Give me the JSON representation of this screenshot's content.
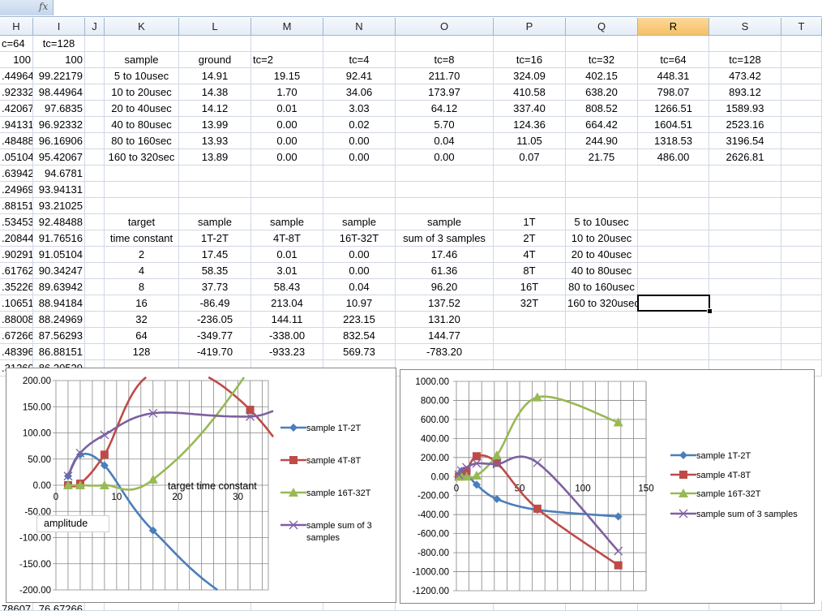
{
  "formula_bar": {
    "fx_label": "fx"
  },
  "columns": [
    "H",
    "I",
    "J",
    "K",
    "L",
    "M",
    "N",
    "O",
    "P",
    "Q",
    "R",
    "S",
    "T"
  ],
  "selected_column": "R",
  "rows": [
    [
      "c=64",
      "tc=128",
      null,
      null,
      null,
      null,
      null,
      null,
      null,
      null,
      null,
      null
    ],
    [
      "100",
      "100",
      null,
      "sample",
      "ground",
      "tc=2",
      "tc=4",
      "tc=8",
      "tc=16",
      "tc=32",
      "tc=64",
      "tc=128"
    ],
    [
      ".44964",
      "99.22179",
      null,
      "5 to 10usec",
      "14.91",
      "19.15",
      "92.41",
      "211.70",
      "324.09",
      "402.15",
      "448.31",
      "473.42"
    ],
    [
      ".92332",
      "98.44964",
      null,
      "10 to 20usec",
      "14.38",
      "1.70",
      "34.06",
      "173.97",
      "410.58",
      "638.20",
      "798.07",
      "893.12"
    ],
    [
      ".42067",
      "97.6835",
      null,
      "20 to 40usec",
      "14.12",
      "0.01",
      "3.03",
      "64.12",
      "337.40",
      "808.52",
      "1266.51",
      "1589.93"
    ],
    [
      ".94131",
      "96.92332",
      null,
      "40 to 80usec",
      "13.99",
      "0.00",
      "0.02",
      "5.70",
      "124.36",
      "664.42",
      "1604.51",
      "2523.16"
    ],
    [
      ".48488",
      "96.16906",
      null,
      "80 to 160sec",
      "13.93",
      "0.00",
      "0.00",
      "0.04",
      "11.05",
      "244.90",
      "1318.53",
      "3196.54"
    ],
    [
      ".05104",
      "95.42067",
      null,
      "160 to 320sec",
      "13.89",
      "0.00",
      "0.00",
      "0.00",
      "0.07",
      "21.75",
      "486.00",
      "2626.81"
    ],
    [
      ".63942",
      "94.6781",
      null,
      null,
      null,
      null,
      null,
      null,
      null,
      null,
      null,
      null
    ],
    [
      ".24969",
      "93.94131",
      null,
      null,
      null,
      null,
      null,
      null,
      null,
      null,
      null,
      null
    ],
    [
      ".88151",
      "93.21025",
      null,
      null,
      null,
      null,
      null,
      null,
      null,
      null,
      null,
      null
    ],
    [
      ".53453",
      "92.48488",
      null,
      "target",
      "sample",
      "sample",
      "sample",
      "sample",
      "1T",
      "5 to 10usec",
      null,
      null
    ],
    [
      ".20844",
      "91.76516",
      null,
      "time constant",
      "1T-2T",
      "4T-8T",
      "16T-32T",
      "sum of 3 samples",
      "2T",
      "10 to 20usec",
      null,
      null
    ],
    [
      ".90291",
      "91.05104",
      null,
      "2",
      "17.45",
      "0.01",
      "0.00",
      "17.46",
      "4T",
      "20 to 40usec",
      null,
      null
    ],
    [
      ".61762",
      "90.34247",
      null,
      "4",
      "58.35",
      "3.01",
      "0.00",
      "61.36",
      "8T",
      "40 to 80usec",
      null,
      null
    ],
    [
      ".35226",
      "89.63942",
      null,
      "8",
      "37.73",
      "58.43",
      "0.04",
      "96.20",
      "16T",
      "80 to 160usec",
      null,
      null
    ],
    [
      ".10651",
      "88.94184",
      null,
      "16",
      "-86.49",
      "213.04",
      "10.97",
      "137.52",
      "32T",
      "160 to 320usec",
      null,
      null
    ],
    [
      ".88008",
      "88.24969",
      null,
      "32",
      "-236.05",
      "144.11",
      "223.15",
      "131.20",
      null,
      null,
      null,
      null
    ],
    [
      ".67266",
      "87.56293",
      null,
      "64",
      "-349.77",
      "-338.00",
      "832.54",
      "144.77",
      null,
      null,
      null,
      null
    ],
    [
      ".48396",
      "86.88151",
      null,
      "128",
      "-419.70",
      "-933.23",
      "569.73",
      "-783.20",
      null,
      null,
      null,
      null
    ],
    [
      ".31260",
      "86.20529",
      null,
      null,
      null,
      null,
      null,
      null,
      null,
      null,
      null,
      null
    ]
  ],
  "bottom_row": [
    "78607",
    "76.67266"
  ],
  "chart_data": [
    {
      "type": "line",
      "title": "",
      "xlabel": "target time constant",
      "ylabel": "amplitude",
      "xlim": [
        0,
        35
      ],
      "ylim": [
        -200,
        200
      ],
      "yticks": [
        "200.00",
        "150.00",
        "100.00",
        "50.00",
        "0.00",
        "-50.00",
        "-100.00",
        "-150.00",
        "-200.00"
      ],
      "ytick_values": [
        200,
        150,
        100,
        50,
        0,
        -50,
        -100,
        -150,
        -200
      ],
      "xticks": [
        "0",
        "10",
        "20",
        "30"
      ],
      "xtick_values": [
        0,
        10,
        20,
        30
      ],
      "grid": true,
      "legend": "right",
      "x": [
        2,
        4,
        8,
        16,
        32,
        64,
        128
      ],
      "series": [
        {
          "name": "sample 1T-2T",
          "values": [
            17.45,
            58.35,
            37.73,
            -86.49,
            -236.05,
            -349.77,
            -419.7
          ],
          "color": "#4A7EBB",
          "marker": "diamond"
        },
        {
          "name": "sample 4T-8T",
          "values": [
            0.01,
            3.01,
            58.43,
            213.04,
            144.11,
            -338.0,
            -933.23
          ],
          "color": "#BE4B48",
          "marker": "square"
        },
        {
          "name": "sample 16T-32T",
          "values": [
            0.0,
            0.0,
            0.04,
            10.97,
            223.15,
            832.54,
            569.73
          ],
          "color": "#98B954",
          "marker": "triangle"
        },
        {
          "name": "sample sum of 3 samples",
          "values": [
            17.46,
            61.36,
            96.2,
            137.52,
            131.2,
            144.77,
            -783.2
          ],
          "color": "#7D60A0",
          "marker": "x"
        }
      ]
    },
    {
      "type": "line",
      "title": "",
      "xlabel": "",
      "ylabel": "",
      "xlim": [
        0,
        150
      ],
      "ylim": [
        -1200,
        1000
      ],
      "yticks": [
        "1000.00",
        "800.00",
        "600.00",
        "400.00",
        "200.00",
        "0.00",
        "-200.00",
        "-400.00",
        "-600.00",
        "-800.00",
        "-1000.00",
        "-1200.00"
      ],
      "ytick_values": [
        1000,
        800,
        600,
        400,
        200,
        0,
        -200,
        -400,
        -600,
        -800,
        -1000,
        -1200
      ],
      "xticks": [
        "0",
        "50",
        "100",
        "150"
      ],
      "xtick_values": [
        0,
        50,
        100,
        150
      ],
      "grid": true,
      "legend": "right",
      "x": [
        2,
        4,
        8,
        16,
        32,
        64,
        128
      ],
      "series": [
        {
          "name": "sample 1T-2T",
          "values": [
            17.45,
            58.35,
            37.73,
            -86.49,
            -236.05,
            -349.77,
            -419.7
          ],
          "color": "#4A7EBB",
          "marker": "diamond"
        },
        {
          "name": "sample 4T-8T",
          "values": [
            0.01,
            3.01,
            58.43,
            213.04,
            144.11,
            -338.0,
            -933.23
          ],
          "color": "#BE4B48",
          "marker": "square"
        },
        {
          "name": "sample 16T-32T",
          "values": [
            0.0,
            0.0,
            0.04,
            10.97,
            223.15,
            832.54,
            569.73
          ],
          "color": "#98B954",
          "marker": "triangle"
        },
        {
          "name": "sample sum of 3 samples",
          "values": [
            17.46,
            61.36,
            96.2,
            137.52,
            131.2,
            144.77,
            -783.2
          ],
          "color": "#7D60A0",
          "marker": "x"
        }
      ]
    }
  ]
}
